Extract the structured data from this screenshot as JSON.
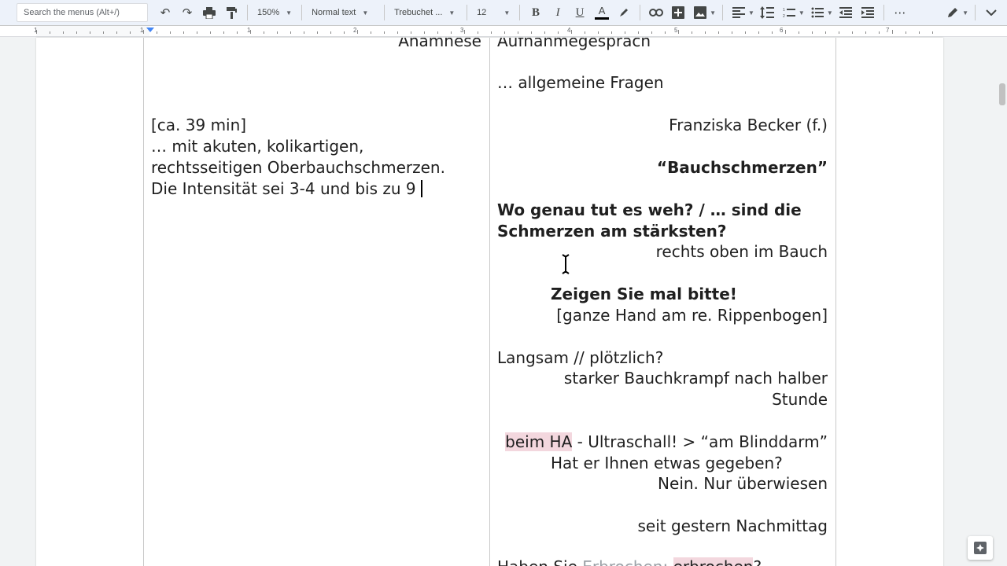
{
  "toolbar": {
    "search_placeholder": "Search the menus (Alt+/)",
    "zoom": "150%",
    "style": "Normal text",
    "font": "Trebuchet ...",
    "font_size": "12",
    "bold_label": "B",
    "italic_label": "I",
    "underline_label": "U",
    "text_color_label": "A",
    "more_label": "⋯"
  },
  "ruler": {
    "numbers": [
      "1",
      "1",
      "1",
      "2",
      "3",
      "4",
      "5",
      "6",
      "7"
    ]
  },
  "document": {
    "left": {
      "header": "Anamnese",
      "time": "[ca. 39 min]",
      "line1": "… mit akuten, kolikartigen,",
      "line2": "rechtsseitigen Oberbauchschmerzen.",
      "line3": "Die Intensität sei 3-4 und bis zu 9"
    },
    "right": {
      "header": "Aufnahmegespräch",
      "general": "… allgemeine Fragen",
      "patient": "Franziska Becker (f.)",
      "topic": "“Bauchschmerzen”",
      "q_where_1": "Wo genau tut es weh? / … sind die",
      "q_where_2": "Schmerzen am stärksten?",
      "a_where": "rechts oben im Bauch",
      "q_show": "Zeigen Sie mal bitte!",
      "a_show": "[ganze Hand am re. Rippenbogen]",
      "q_onset": "Langsam // plötzlich?",
      "a_onset_1": "starker Bauchkrampf nach halber",
      "a_onset_2": "Stunde",
      "ha_highlight": "beim HA",
      "ha_rest": " - Ultraschall! > “am Blinddarm”",
      "q_given": "Hat er Ihnen etwas gegeben?",
      "a_given": "Nein. Nur überwiesen",
      "since": "seit gestern Nachmittag",
      "q_vomit_start": "Haben Sie ",
      "q_vomit_grey": "Erbrochen; ",
      "q_vomit_hl": "erbrochen",
      "q_vomit_end": "?"
    }
  }
}
